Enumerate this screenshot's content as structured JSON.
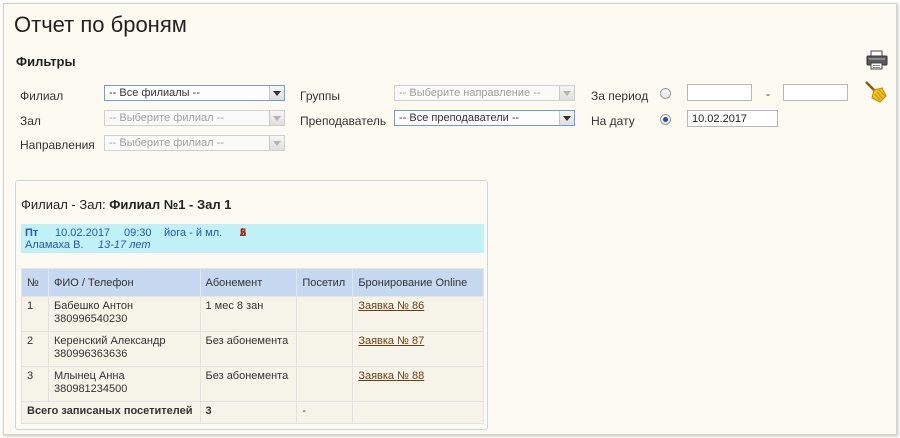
{
  "page": {
    "title": "Отчет по броням"
  },
  "filters": {
    "section_title": "Фильтры",
    "branch": {
      "label": "Филиал",
      "value": "-- Все филиалы --"
    },
    "hall": {
      "label": "Зал",
      "value": "-- Выберите филиал --"
    },
    "direction": {
      "label": "Направления",
      "value": "-- Выберите филиал --"
    },
    "groups": {
      "label": "Группы",
      "value": "-- Выберите направление --"
    },
    "teacher": {
      "label": "Преподаватель",
      "value": "-- Все преподаватели --"
    },
    "period": {
      "label": "За период",
      "from": "",
      "to": "",
      "dash": "-"
    },
    "on_date": {
      "label": "На дату",
      "value": "10.02.2017"
    }
  },
  "icons": {
    "print": "printer-icon",
    "clear": "broom-icon"
  },
  "report": {
    "heading_prefix": "Филиал - Зал:",
    "heading_value": "Филиал №1 - Зал 1",
    "session": {
      "day": "Пт",
      "date": "10.02.2017",
      "time": "09:30",
      "direction": "йога - й мл.",
      "count_a": "2",
      "count_b": "3",
      "count_c": "5",
      "sep": "/",
      "teacher": "Аламаха В.",
      "age": "13-17 лет"
    },
    "columns": [
      "№",
      "ФИО / Телефон",
      "Абонемент",
      "Посетил",
      "Бронирование Online"
    ],
    "rows": [
      {
        "num": "1",
        "name": "Бабешко Антон",
        "phone": "380996540230",
        "subscription": "1 мес 8 зан",
        "visited": "",
        "booking": "Заявка № 86"
      },
      {
        "num": "2",
        "name": "Керенский Александр",
        "phone": "380996363636",
        "subscription": "Без абонемента",
        "visited": "",
        "booking": "Заявка № 87"
      },
      {
        "num": "3",
        "name": "Млынец Анна",
        "phone": "380981234500",
        "subscription": "Без абонемента",
        "visited": "",
        "booking": "Заявка № 88"
      }
    ],
    "total": {
      "label": "Всего записаных посетителей",
      "count": "3",
      "visited": "-"
    }
  },
  "colors": {
    "header_bg": "#c6d9f0",
    "session_bg": "#bff1f6",
    "link": "#6b3f10",
    "page_bg": "#fdfbf1"
  }
}
